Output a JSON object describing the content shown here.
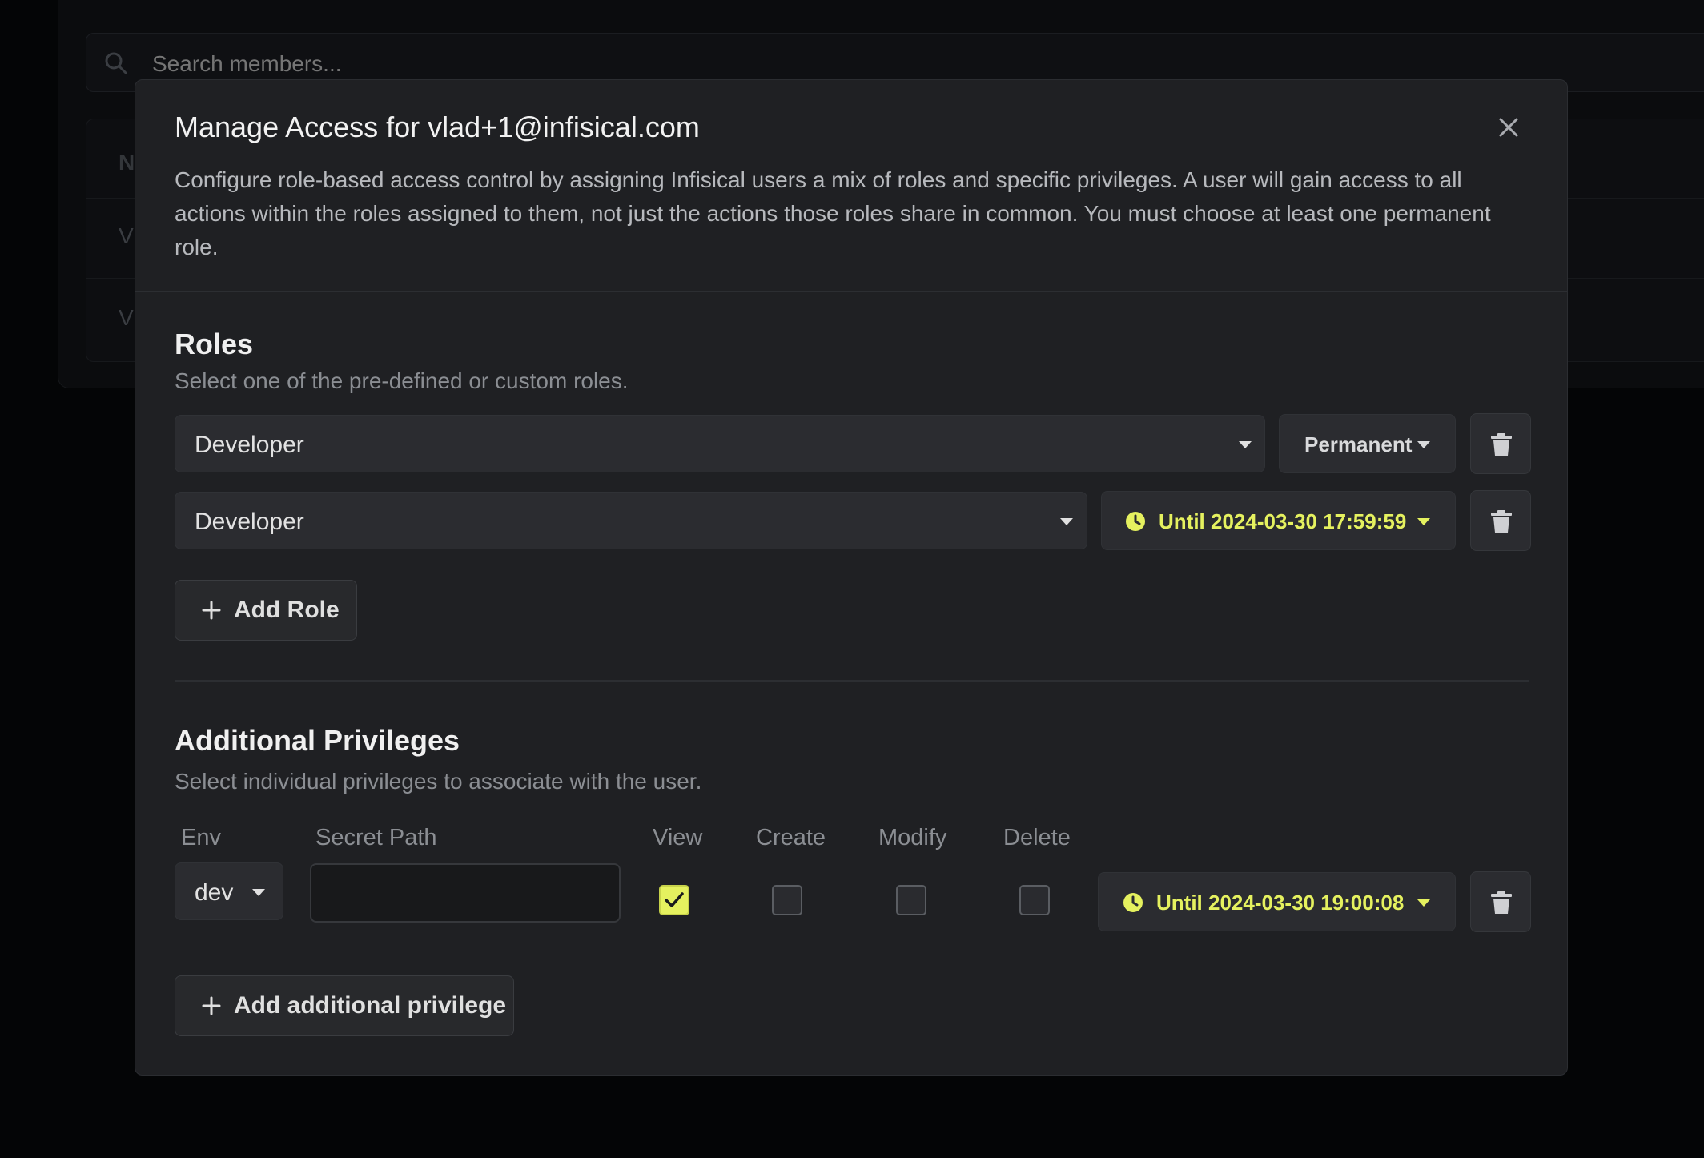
{
  "background": {
    "search_placeholder": "Search members...",
    "table_header_initial": "N",
    "row_initials": [
      "V",
      "V"
    ]
  },
  "modal": {
    "title": "Manage Access for vlad+1@infisical.com",
    "description": "Configure role-based access control by assigning Infisical users a mix of roles and specific privileges. A user will gain access to all actions within the roles assigned to them, not just the actions those roles share in common. You must choose at least one permanent role.",
    "roles": {
      "title": "Roles",
      "subtitle": "Select one of the pre-defined or custom roles.",
      "items": [
        {
          "role": "Developer",
          "duration": "Permanent",
          "temporary": false
        },
        {
          "role": "Developer",
          "duration": "Until 2024-03-30 17:59:59",
          "temporary": true
        }
      ],
      "add_label": "Add Role"
    },
    "privileges": {
      "title": "Additional Privileges",
      "subtitle": "Select individual privileges to associate with the user.",
      "columns": {
        "env": "Env",
        "secret_path": "Secret Path",
        "view": "View",
        "create": "Create",
        "modify": "Modify",
        "delete": "Delete"
      },
      "items": [
        {
          "env": "dev",
          "secret_path": "",
          "view": true,
          "create": false,
          "modify": false,
          "delete": false,
          "duration": "Until 2024-03-30 19:00:08"
        }
      ],
      "add_label": "Add additional privilege"
    }
  },
  "colors": {
    "accent": "#e5f15f",
    "modal_bg": "#1f2023",
    "control_bg": "#2b2c30"
  },
  "icons": [
    "search-icon",
    "close-icon",
    "chevron-down-icon",
    "clock-icon",
    "trash-icon",
    "plus-icon",
    "check-icon"
  ]
}
